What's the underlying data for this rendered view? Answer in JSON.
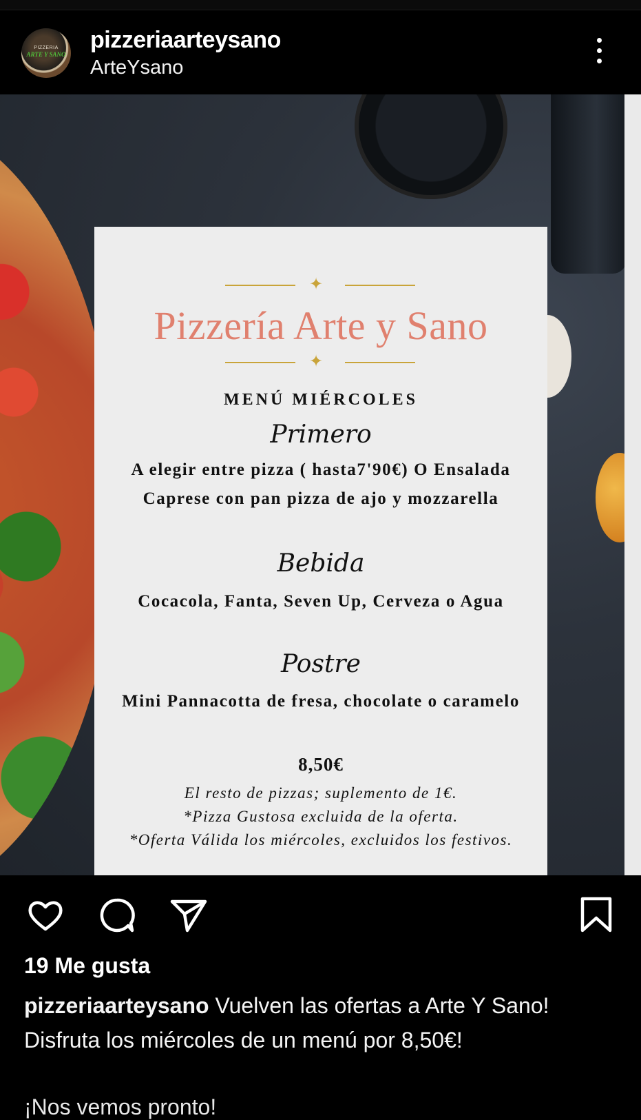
{
  "post": {
    "username": "pizzeriaarteysano",
    "subtitle": "ArteYsano",
    "avatar": {
      "logo_top": "PIZZERIA",
      "logo_main": "ARTE Y SANO"
    }
  },
  "menu_card": {
    "title": "Pizzería Arte y Sano",
    "day": "MENÚ MIÉRCOLES",
    "section1_heading": "Primero",
    "section1_body": "A elegir entre pizza ( hasta7'90€)  O Ensalada Caprese con pan pizza de ajo y mozzarella",
    "section2_heading": "Bebida",
    "section2_body": "Cocacola, Fanta, Seven Up, Cerveza o Agua",
    "section3_heading": "Postre",
    "section3_body": "Mini Pannacotta de fresa, chocolate o caramelo",
    "price": "8,50€",
    "note1": "El resto de pizzas; suplemento de 1€.",
    "note2": "*Pizza Gustosa excluida de la oferta.",
    "note3": "*Oferta Válida los miércoles, excluidos los festivos."
  },
  "actions": {
    "like_icon": "heart-icon",
    "comment_icon": "comment-icon",
    "share_icon": "send-icon",
    "save_icon": "bookmark-icon"
  },
  "likes_text": "19 Me gusta",
  "caption": {
    "user": "pizzeriaarteysano",
    "text": " Vuelven las ofertas a Arte Y Sano! Disfruta los miércoles de un menú por 8,50€!",
    "next_line": "¡Nos vemos pronto!"
  },
  "colors": {
    "background": "#000000",
    "title_accent": "#e0806e",
    "ornament_gold": "#c9a43a",
    "card_bg": "#ededed"
  }
}
